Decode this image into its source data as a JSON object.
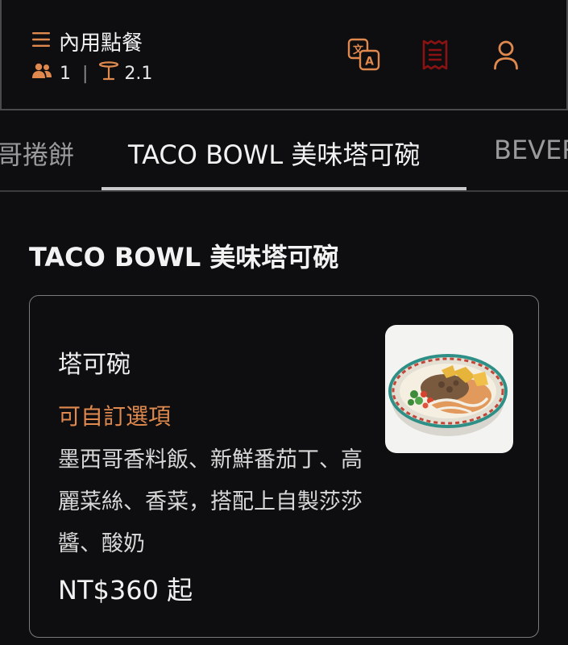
{
  "header": {
    "mode_icon": "menu-icon",
    "mode_label": "內用點餐",
    "guests_icon": "people-icon",
    "guests_count": "1",
    "separator": "|",
    "table_icon": "table-icon",
    "table_number": "2.1",
    "language_icon": "translate-icon",
    "receipt_icon": "receipt-icon",
    "account_icon": "user-icon"
  },
  "tabs": [
    {
      "label": "墨西哥捲餅",
      "active": false
    },
    {
      "label": "TACO BOWL 美味塔可碗",
      "active": true
    },
    {
      "label": "BEVERAGES",
      "active": false
    }
  ],
  "section": {
    "title": "TACO BOWL 美味塔可碗"
  },
  "items": [
    {
      "name": "塔可碗",
      "tag": "可自訂選項",
      "description": "墨西哥香料飯、新鮮番茄丁、高麗菜絲、香菜，搭配上自製莎莎醬、酸奶",
      "price": "NT$360 起",
      "image_icon": "taco-bowl-photo"
    }
  ],
  "colors": {
    "background": "#0e0e10",
    "accent_orange": "#e0894e",
    "receipt_red": "#8b1212",
    "text_primary": "#f0f0f0",
    "text_muted": "#9a9a9c",
    "border": "#7a7a7c"
  }
}
